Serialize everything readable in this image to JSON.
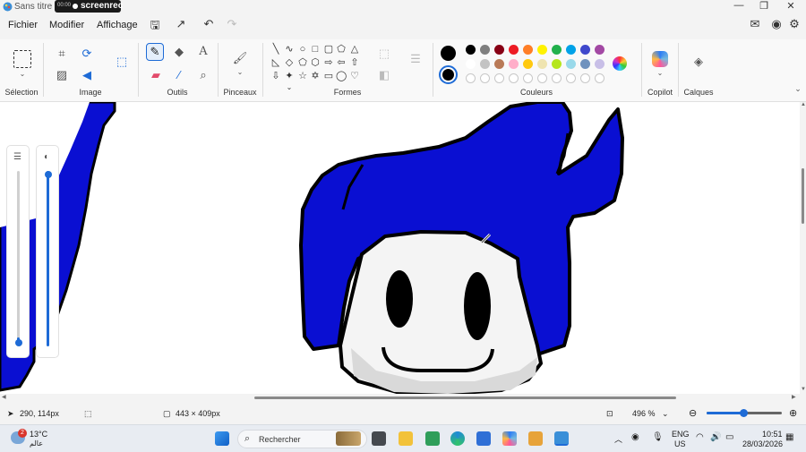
{
  "window": {
    "title": "Sans titre - P",
    "minimize": "—",
    "restore": "❐",
    "close": "✕"
  },
  "recorder": {
    "time": "00:00",
    "brand": "screenrec"
  },
  "menu": {
    "file": "Fichier",
    "edit": "Modifier",
    "view": "Affichage"
  },
  "ribbon": {
    "groups": {
      "selection": "Sélection",
      "image": "Image",
      "tools": "Outils",
      "brushes": "Pinceaux",
      "shapes": "Formes",
      "colors": "Couleurs",
      "copilot": "Copilot",
      "layers": "Calques"
    },
    "palette_row1": [
      "#000000",
      "#7f7f7f",
      "#880015",
      "#ed1c24",
      "#ff7f27",
      "#fff200",
      "#22b14c",
      "#00a2e8",
      "#3f48cc",
      "#a349a4"
    ],
    "palette_row2": [
      "#ffffff",
      "#c3c3c3",
      "#b97a57",
      "#ffaec9",
      "#ffc90e",
      "#efe4b0",
      "#b5e61d",
      "#99d9ea",
      "#7092be",
      "#c8bfe7"
    ],
    "primary_color": "#000000",
    "secondary_color": "#000000"
  },
  "canvas": {
    "brush_color": "#0a0fd2"
  },
  "status": {
    "cursor_position": "290, 114px",
    "image_size": "443 × 409px",
    "zoom_level": "496 %",
    "zoom_fraction": 0.5
  },
  "taskbar": {
    "weather_temp": "13°C",
    "weather_desc": "عالم",
    "weather_badge": "2",
    "search_placeholder": "Rechercher",
    "language": "ENG",
    "region": "US",
    "time": "10:51",
    "date": "28/03/2026"
  }
}
